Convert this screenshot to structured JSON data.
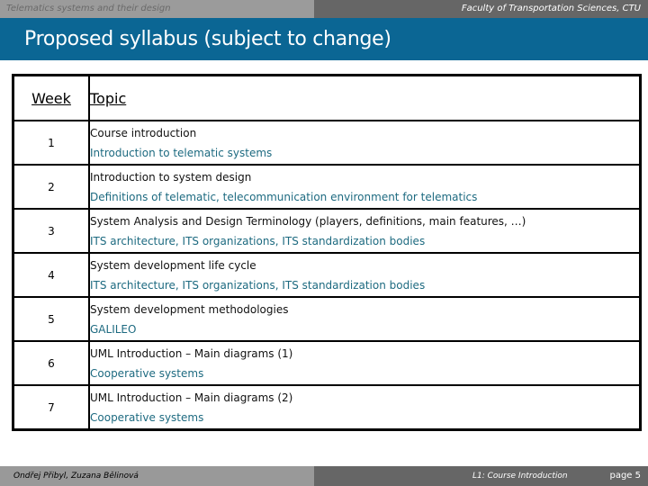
{
  "header": {
    "course_title": "Telematics systems and their design",
    "faculty": "Faculty of Transportation Sciences, CTU"
  },
  "slide": {
    "title": "Proposed syllabus (subject to change)"
  },
  "table": {
    "columns": [
      "Week",
      "Topic"
    ],
    "rows": [
      {
        "week": "1",
        "main": "Course introduction",
        "sub": "Introduction to telematic systems"
      },
      {
        "week": "2",
        "main": "Introduction to system design",
        "sub": "Definitions of telematic, telecommunication environment for telematics"
      },
      {
        "week": "3",
        "main": "System Analysis and Design Terminology (players, definitions, main features, …)",
        "sub": "ITS architecture, ITS organizations, ITS standardization bodies"
      },
      {
        "week": "4",
        "main": "System development life cycle",
        "sub": "ITS architecture, ITS organizations, ITS standardization bodies"
      },
      {
        "week": "5",
        "main": "System development methodologies",
        "sub": "GALILEO"
      },
      {
        "week": "6",
        "main": "UML Introduction – Main diagrams (1)",
        "sub": "Cooperative systems"
      },
      {
        "week": "7",
        "main": "UML Introduction – Main diagrams (2)",
        "sub": "Cooperative systems"
      }
    ]
  },
  "footer": {
    "authors": "Ondřej Přibyl, Zuzana Bělinová",
    "lecture": "L1: Course Introduction",
    "page": "page 5"
  },
  "colors": {
    "title_bar": "#0b6694",
    "header_left": "#9b9b9b",
    "header_right": "#666666",
    "subtopic_text": "#1d6a80"
  }
}
